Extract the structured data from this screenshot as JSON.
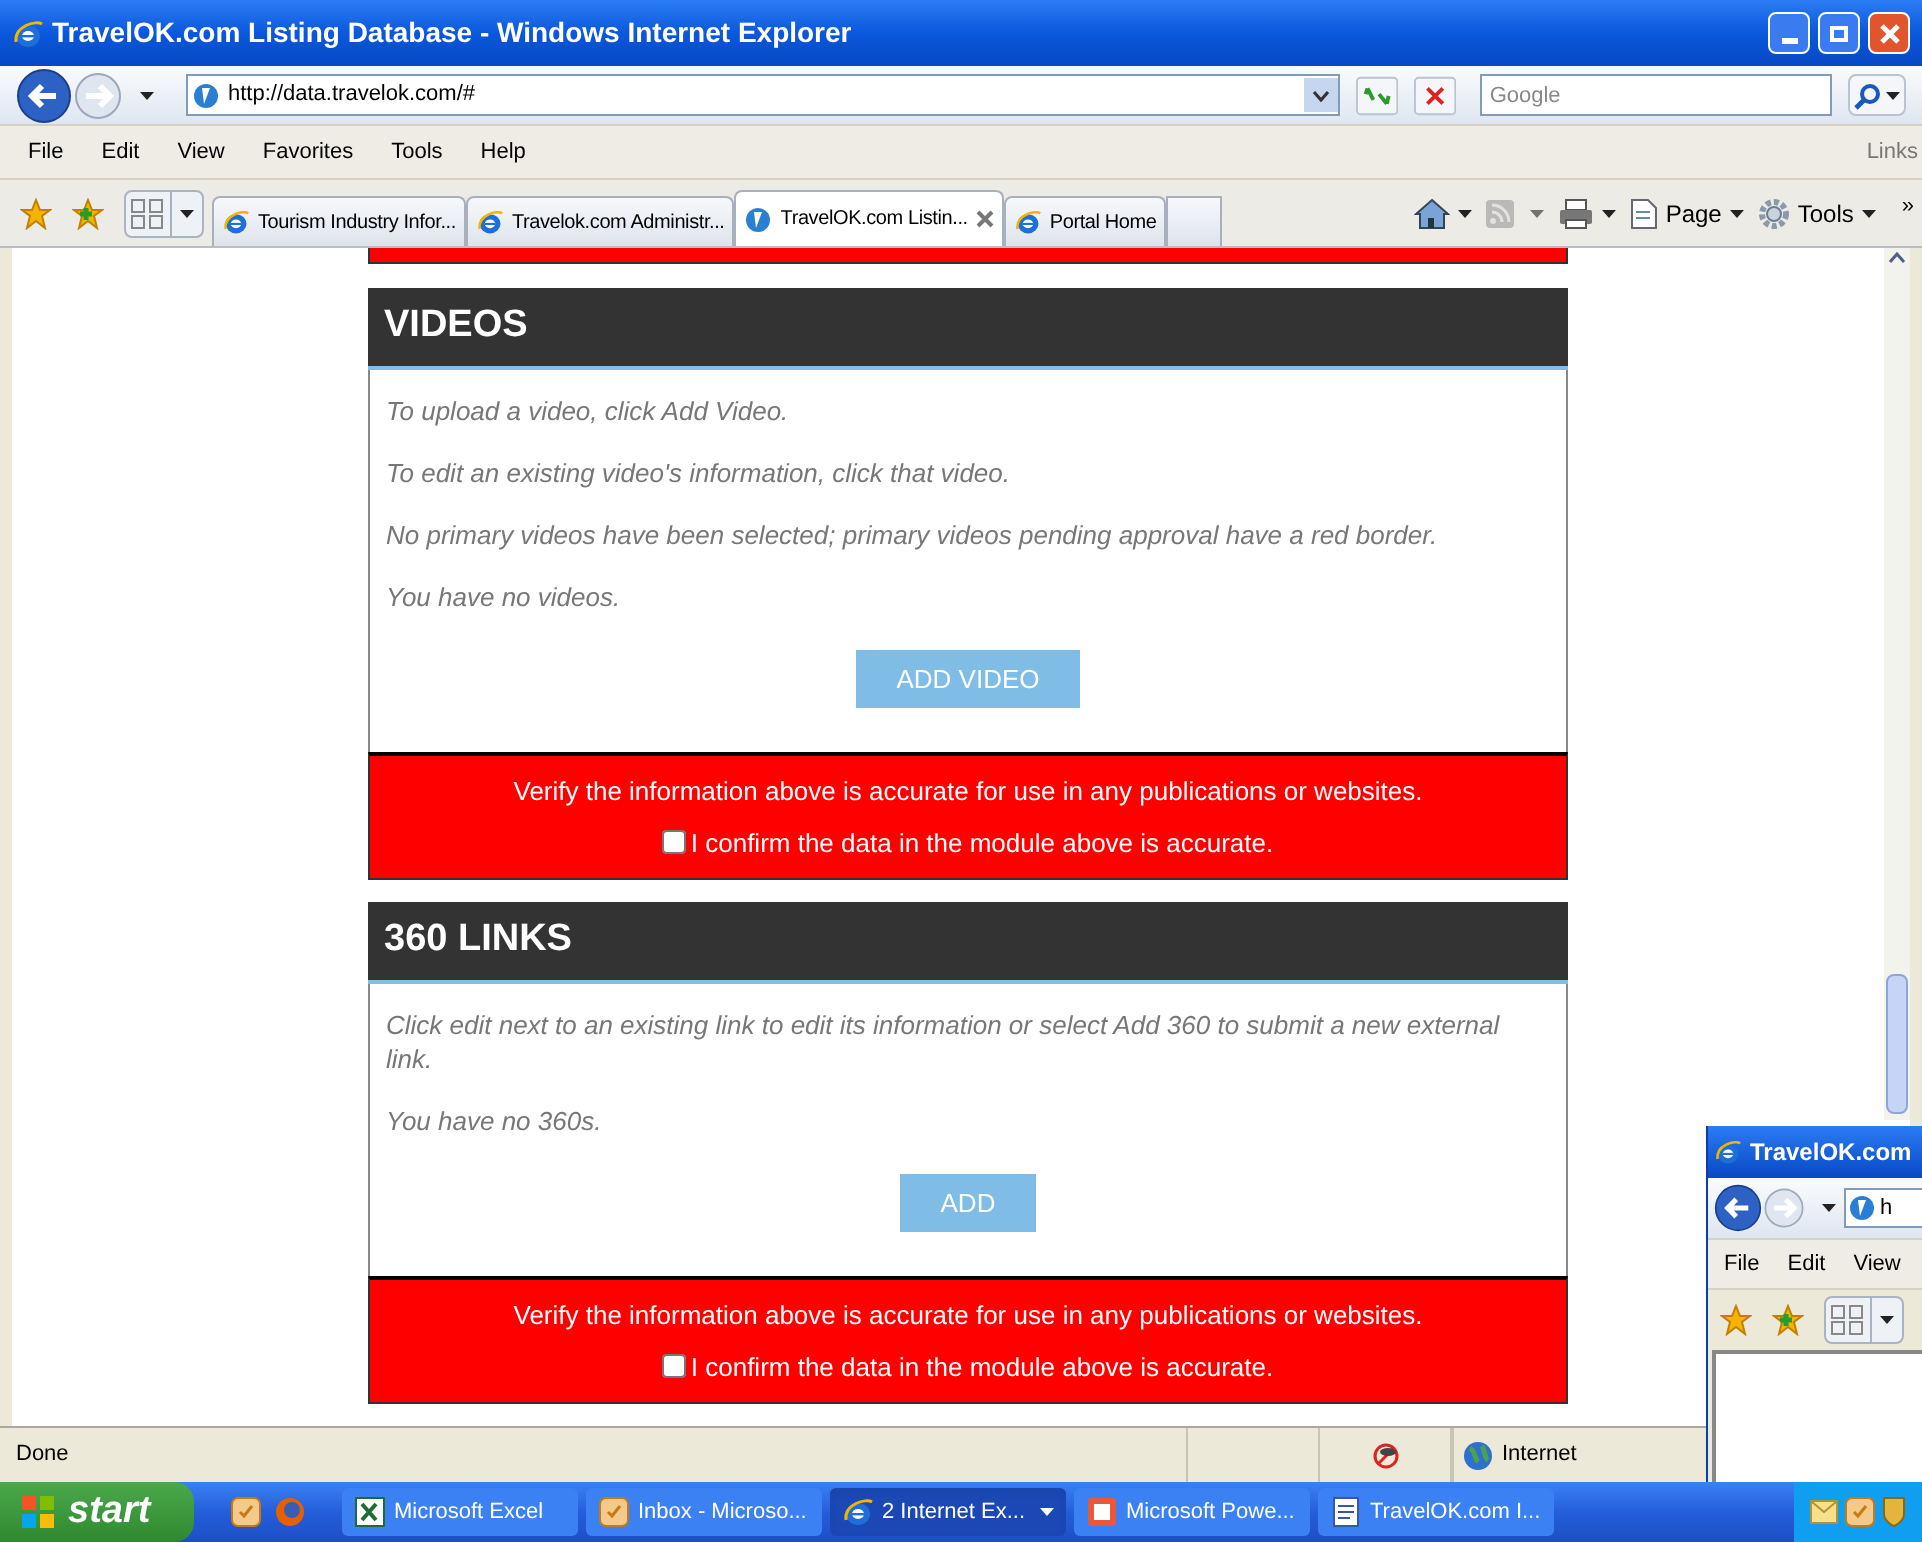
{
  "window": {
    "title": "TravelOK.com Listing Database - Windows Internet Explorer"
  },
  "address_bar": {
    "url": "http://data.travelok.com/#"
  },
  "search": {
    "placeholder": "Google"
  },
  "menu": [
    "File",
    "Edit",
    "View",
    "Favorites",
    "Tools",
    "Help"
  ],
  "links_label": "Links",
  "toolbar_overflow": "»",
  "tabs": [
    {
      "label": "Tourism Industry Infor...",
      "selected": false
    },
    {
      "label": "Travelok.com Administr...",
      "selected": false
    },
    {
      "label": "TravelOK.com Listin...",
      "selected": true
    },
    {
      "label": "Portal Home",
      "selected": false
    }
  ],
  "toolbar": [
    {
      "kind": "home"
    },
    {
      "kind": "feeds"
    },
    {
      "kind": "print"
    },
    {
      "kind": "page",
      "label": "Page"
    },
    {
      "kind": "tools",
      "label": "Tools"
    }
  ],
  "modules": [
    {
      "title": "VIDEOS",
      "paragraphs": [
        "To upload a video, click Add Video.",
        "To edit an existing video's information, click that video.",
        "No primary videos have been selected; primary videos pending approval have a red border.",
        "You have no videos."
      ],
      "button": "ADD VIDEO",
      "verify": "Verify the information above is accurate for use in any publications or websites.",
      "confirm": {
        "label": "I confirm the data in the module above is accurate.",
        "checked": false
      }
    },
    {
      "title": "360 LINKS",
      "paragraphs": [
        "Click edit next to an existing link to edit its information or select Add 360 to submit a new external link.",
        "You have no 360s."
      ],
      "button": "ADD",
      "verify": "Verify the information above is accurate for use in any publications or websites.",
      "confirm": {
        "label": "I confirm the data in the module above is accurate.",
        "checked": false
      }
    }
  ],
  "status_bar": {
    "status": "Done",
    "zone": "Internet"
  },
  "taskbar": {
    "start": "start",
    "tasks": [
      {
        "label": "Microsoft Excel",
        "kind": "excel",
        "selected": false
      },
      {
        "label": "Inbox - Microso...",
        "kind": "outlook",
        "selected": false
      },
      {
        "label": "2 Internet Ex...",
        "kind": "ie",
        "selected": true
      },
      {
        "label": "Microsoft Powe...",
        "kind": "powerpoint",
        "selected": false
      },
      {
        "label": "TravelOK.com I...",
        "kind": "doc",
        "selected": false
      }
    ]
  },
  "second_window": {
    "title": "TravelOK.com",
    "url": "h",
    "menu": [
      "File",
      "Edit",
      "View"
    ]
  }
}
